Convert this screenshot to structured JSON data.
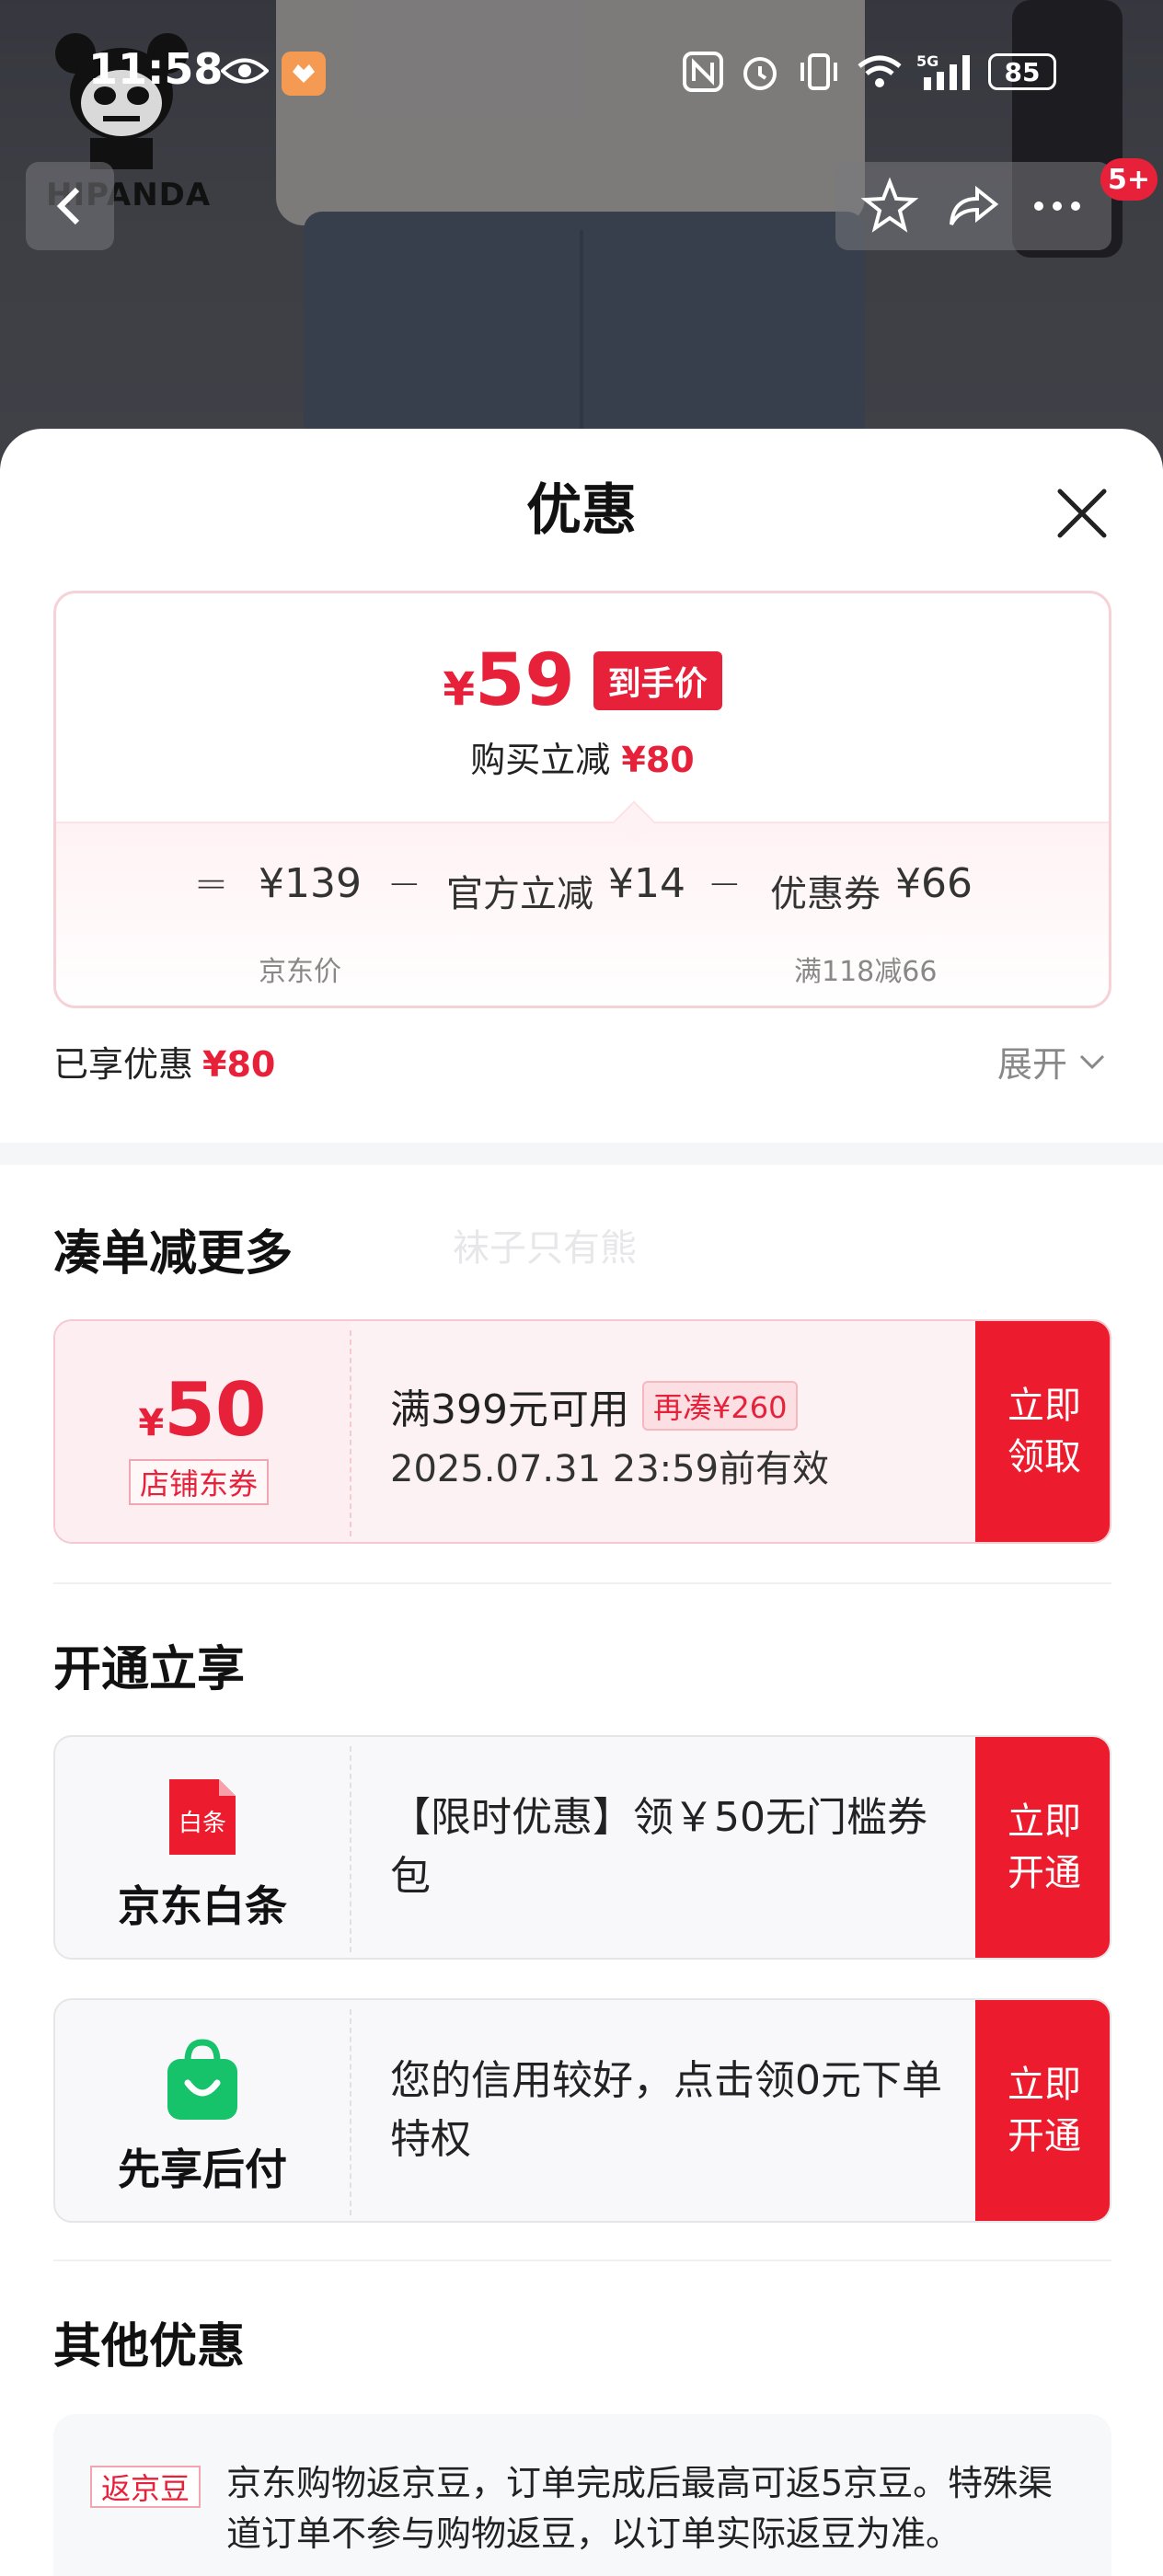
{
  "status_bar": {
    "time": "11:58",
    "battery": "85"
  },
  "brand": {
    "logo_text": "HIPANDA"
  },
  "nav": {
    "badge": "5+"
  },
  "sheet": {
    "title": "优惠",
    "price": {
      "currency": "¥",
      "final": "59",
      "final_tag": "到手价",
      "save_label": "购买立减",
      "save_amount": "¥80",
      "eq": "=",
      "minus": "−",
      "jd_price": "¥139",
      "jd_price_label": "京东价",
      "official_label": "官方立减",
      "official_amount": "¥14",
      "coupon_label": "优惠券",
      "coupon_amount": "¥66",
      "coupon_note": "满118减66"
    },
    "enjoyed_label": "已享优惠",
    "enjoyed_amount": "¥80",
    "expand_label": "展开"
  },
  "section_more": {
    "title": "凑单减更多",
    "ghost_text": "袜子只有熊",
    "coupon": {
      "currency": "¥",
      "amount": "50",
      "type": "店铺东券",
      "condition": "满399元可用",
      "more_tag": "再凑¥260",
      "validity": "2025.07.31 23:59前有效",
      "action": "立即领取"
    }
  },
  "section_open": {
    "title": "开通立享",
    "items": [
      {
        "name": "京东白条",
        "icon_text": "白条",
        "desc": "【限时优惠】领￥50无门槛券包",
        "action": "立即开通"
      },
      {
        "name": "先享后付",
        "desc": "您的信用较好，点击领0元下单特权",
        "action": "立即开通"
      }
    ]
  },
  "section_other": {
    "title": "其他优惠",
    "tag": "返京豆",
    "text": "京东购物返京豆，订单完成后最高可返5京豆。特殊渠道订单不参与购物返豆，以订单实际返豆为准。"
  },
  "colors": {
    "accent": "#e8213a",
    "action_bg": "#ec1c2e",
    "bag_green": "#17c36a"
  }
}
